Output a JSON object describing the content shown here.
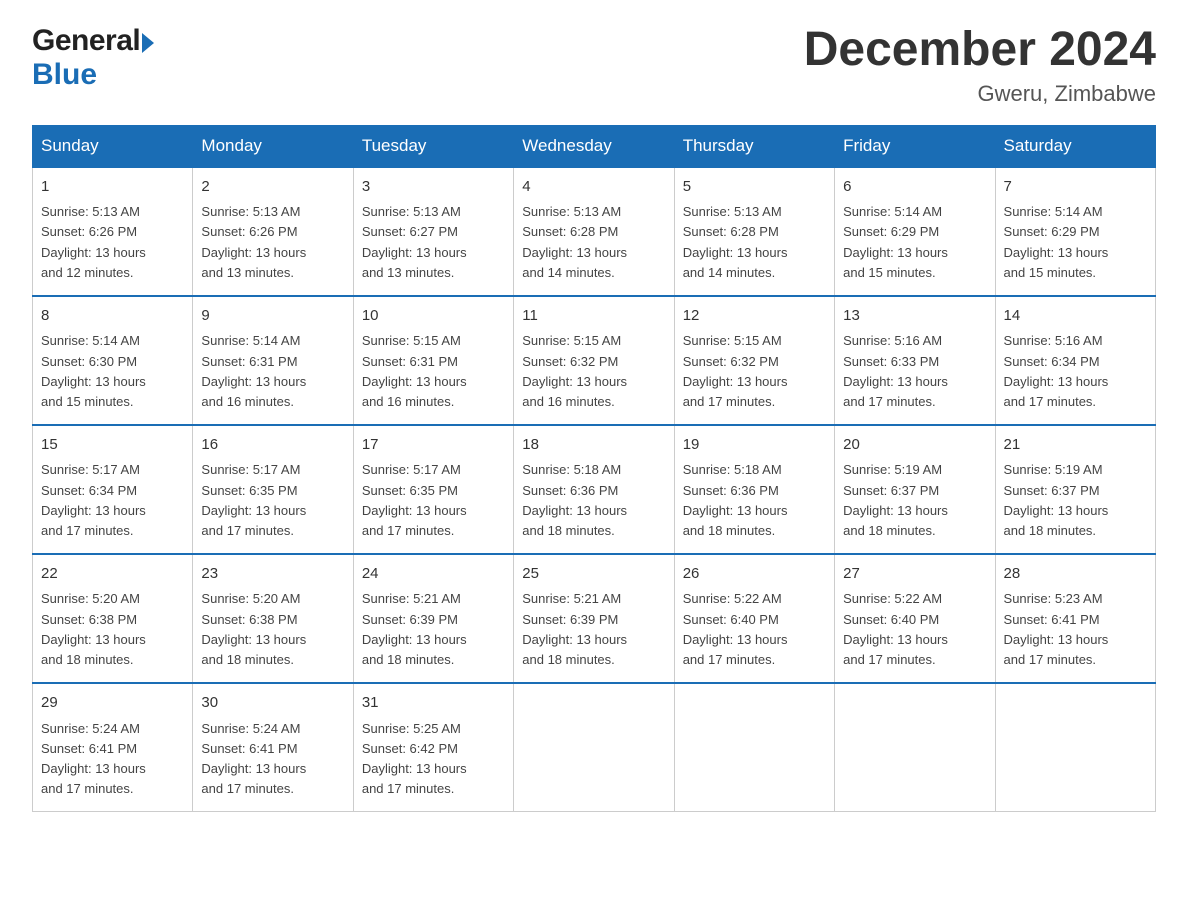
{
  "logo": {
    "general": "General",
    "blue": "Blue"
  },
  "header": {
    "title": "December 2024",
    "location": "Gweru, Zimbabwe"
  },
  "weekdays": [
    "Sunday",
    "Monday",
    "Tuesday",
    "Wednesday",
    "Thursday",
    "Friday",
    "Saturday"
  ],
  "weeks": [
    [
      {
        "day": "1",
        "sunrise": "5:13 AM",
        "sunset": "6:26 PM",
        "daylight": "13 hours and 12 minutes."
      },
      {
        "day": "2",
        "sunrise": "5:13 AM",
        "sunset": "6:26 PM",
        "daylight": "13 hours and 13 minutes."
      },
      {
        "day": "3",
        "sunrise": "5:13 AM",
        "sunset": "6:27 PM",
        "daylight": "13 hours and 13 minutes."
      },
      {
        "day": "4",
        "sunrise": "5:13 AM",
        "sunset": "6:28 PM",
        "daylight": "13 hours and 14 minutes."
      },
      {
        "day": "5",
        "sunrise": "5:13 AM",
        "sunset": "6:28 PM",
        "daylight": "13 hours and 14 minutes."
      },
      {
        "day": "6",
        "sunrise": "5:14 AM",
        "sunset": "6:29 PM",
        "daylight": "13 hours and 15 minutes."
      },
      {
        "day": "7",
        "sunrise": "5:14 AM",
        "sunset": "6:29 PM",
        "daylight": "13 hours and 15 minutes."
      }
    ],
    [
      {
        "day": "8",
        "sunrise": "5:14 AM",
        "sunset": "6:30 PM",
        "daylight": "13 hours and 15 minutes."
      },
      {
        "day": "9",
        "sunrise": "5:14 AM",
        "sunset": "6:31 PM",
        "daylight": "13 hours and 16 minutes."
      },
      {
        "day": "10",
        "sunrise": "5:15 AM",
        "sunset": "6:31 PM",
        "daylight": "13 hours and 16 minutes."
      },
      {
        "day": "11",
        "sunrise": "5:15 AM",
        "sunset": "6:32 PM",
        "daylight": "13 hours and 16 minutes."
      },
      {
        "day": "12",
        "sunrise": "5:15 AM",
        "sunset": "6:32 PM",
        "daylight": "13 hours and 17 minutes."
      },
      {
        "day": "13",
        "sunrise": "5:16 AM",
        "sunset": "6:33 PM",
        "daylight": "13 hours and 17 minutes."
      },
      {
        "day": "14",
        "sunrise": "5:16 AM",
        "sunset": "6:34 PM",
        "daylight": "13 hours and 17 minutes."
      }
    ],
    [
      {
        "day": "15",
        "sunrise": "5:17 AM",
        "sunset": "6:34 PM",
        "daylight": "13 hours and 17 minutes."
      },
      {
        "day": "16",
        "sunrise": "5:17 AM",
        "sunset": "6:35 PM",
        "daylight": "13 hours and 17 minutes."
      },
      {
        "day": "17",
        "sunrise": "5:17 AM",
        "sunset": "6:35 PM",
        "daylight": "13 hours and 17 minutes."
      },
      {
        "day": "18",
        "sunrise": "5:18 AM",
        "sunset": "6:36 PM",
        "daylight": "13 hours and 18 minutes."
      },
      {
        "day": "19",
        "sunrise": "5:18 AM",
        "sunset": "6:36 PM",
        "daylight": "13 hours and 18 minutes."
      },
      {
        "day": "20",
        "sunrise": "5:19 AM",
        "sunset": "6:37 PM",
        "daylight": "13 hours and 18 minutes."
      },
      {
        "day": "21",
        "sunrise": "5:19 AM",
        "sunset": "6:37 PM",
        "daylight": "13 hours and 18 minutes."
      }
    ],
    [
      {
        "day": "22",
        "sunrise": "5:20 AM",
        "sunset": "6:38 PM",
        "daylight": "13 hours and 18 minutes."
      },
      {
        "day": "23",
        "sunrise": "5:20 AM",
        "sunset": "6:38 PM",
        "daylight": "13 hours and 18 minutes."
      },
      {
        "day": "24",
        "sunrise": "5:21 AM",
        "sunset": "6:39 PM",
        "daylight": "13 hours and 18 minutes."
      },
      {
        "day": "25",
        "sunrise": "5:21 AM",
        "sunset": "6:39 PM",
        "daylight": "13 hours and 18 minutes."
      },
      {
        "day": "26",
        "sunrise": "5:22 AM",
        "sunset": "6:40 PM",
        "daylight": "13 hours and 17 minutes."
      },
      {
        "day": "27",
        "sunrise": "5:22 AM",
        "sunset": "6:40 PM",
        "daylight": "13 hours and 17 minutes."
      },
      {
        "day": "28",
        "sunrise": "5:23 AM",
        "sunset": "6:41 PM",
        "daylight": "13 hours and 17 minutes."
      }
    ],
    [
      {
        "day": "29",
        "sunrise": "5:24 AM",
        "sunset": "6:41 PM",
        "daylight": "13 hours and 17 minutes."
      },
      {
        "day": "30",
        "sunrise": "5:24 AM",
        "sunset": "6:41 PM",
        "daylight": "13 hours and 17 minutes."
      },
      {
        "day": "31",
        "sunrise": "5:25 AM",
        "sunset": "6:42 PM",
        "daylight": "13 hours and 17 minutes."
      },
      null,
      null,
      null,
      null
    ]
  ],
  "labels": {
    "sunrise": "Sunrise:",
    "sunset": "Sunset:",
    "daylight": "Daylight:"
  }
}
